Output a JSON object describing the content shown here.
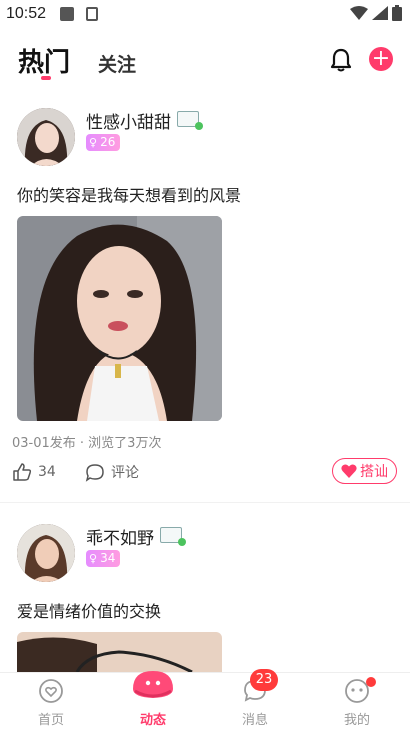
{
  "status_bar": {
    "time": "10:52"
  },
  "header": {
    "tabs": [
      {
        "label": "热门",
        "active": true
      },
      {
        "label": "关注",
        "active": false
      }
    ],
    "add_symbol": "+"
  },
  "posts": [
    {
      "username": "性感小甜甜",
      "age": "26",
      "caption": "你的笑容是我每天想看到的风景",
      "meta": "03-01发布 · 浏览了3万次",
      "likes": "34",
      "comment_label": "评论",
      "chat_label": "搭讪"
    },
    {
      "username": "乖不如野",
      "age": "34",
      "caption": "爱是情绪价值的交换"
    }
  ],
  "bottom_nav": {
    "items": [
      {
        "label": "首页",
        "icon": "home-heart-icon"
      },
      {
        "label": "动态",
        "icon": "moments-icon",
        "active": true
      },
      {
        "label": "消息",
        "icon": "message-icon",
        "badge": "23"
      },
      {
        "label": "我的",
        "icon": "profile-icon",
        "dot": true
      }
    ]
  },
  "colors": {
    "accent": "#ff3b6b",
    "badge_red": "#ff3b3b",
    "age_badge": "#e58cff"
  }
}
